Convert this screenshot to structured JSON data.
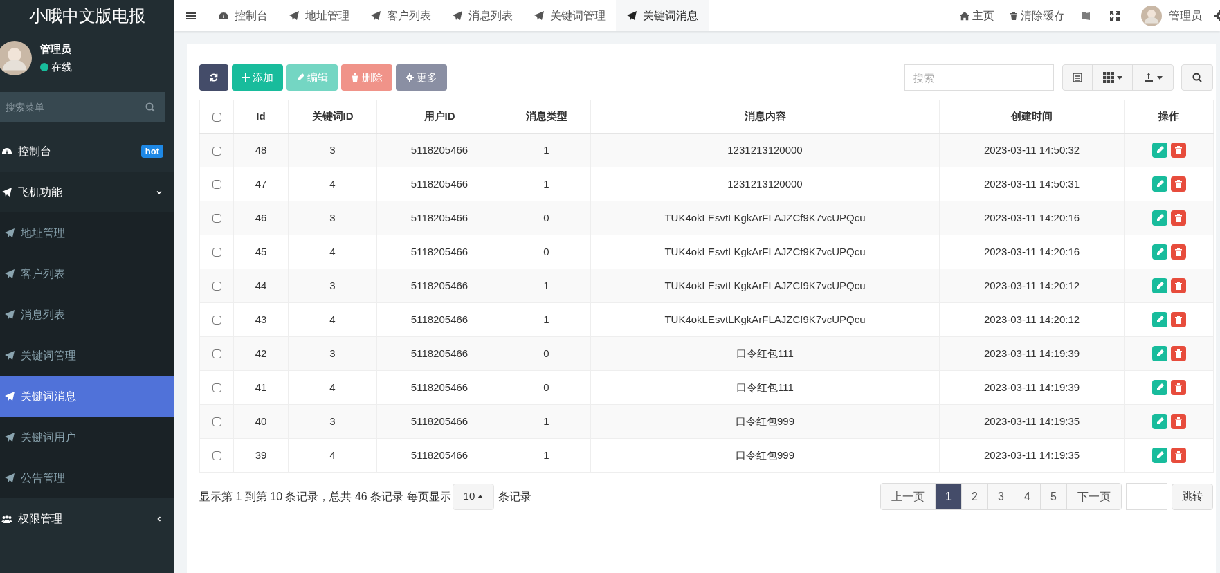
{
  "sidebar": {
    "title": "小哦中文版电报",
    "user": {
      "name": "管理员",
      "status": "在线"
    },
    "search": {
      "placeholder": "搜索菜单"
    },
    "items": [
      {
        "label": "控制台",
        "kind": "dashboard",
        "badge": "hot",
        "selected": false
      },
      {
        "label": "飞机功能",
        "kind": "plane",
        "expanded": true,
        "selected": false,
        "children": [
          {
            "label": "地址管理",
            "selected": false
          },
          {
            "label": "客户列表",
            "selected": false
          },
          {
            "label": "消息列表",
            "selected": false
          },
          {
            "label": "关键词管理",
            "selected": false
          },
          {
            "label": "关键词消息",
            "selected": true
          },
          {
            "label": "关键词用户",
            "selected": false
          },
          {
            "label": "公告管理",
            "selected": false
          }
        ]
      },
      {
        "label": "权限管理",
        "kind": "users",
        "expanded": false,
        "selected": false
      }
    ]
  },
  "tabs": [
    {
      "label": "控制台",
      "kind": "dashboard",
      "selected": false
    },
    {
      "label": "地址管理",
      "kind": "plane",
      "selected": false
    },
    {
      "label": "客户列表",
      "kind": "plane",
      "selected": false
    },
    {
      "label": "消息列表",
      "kind": "plane",
      "selected": false
    },
    {
      "label": "关键词管理",
      "kind": "plane",
      "selected": false
    },
    {
      "label": "关键词消息",
      "kind": "plane",
      "selected": true
    }
  ],
  "top_right": {
    "home": "主页",
    "clear_cache": "清除缓存",
    "user": "管理员"
  },
  "toolbar": {
    "buttons": [
      {
        "kind": "refresh",
        "disabled": false
      },
      {
        "kind": "add",
        "label": "添加",
        "disabled": false
      },
      {
        "kind": "edit",
        "label": "编辑",
        "disabled": true
      },
      {
        "kind": "delete",
        "label": "删除",
        "disabled": true
      },
      {
        "kind": "more",
        "label": "更多",
        "disabled": false
      }
    ],
    "search": {
      "placeholder": "搜索"
    }
  },
  "table": {
    "select_all_checked": false,
    "columns": [
      "Id",
      "关键词ID",
      "用户ID",
      "消息类型",
      "消息内容",
      "创建时间",
      "操作"
    ],
    "rows": [
      {
        "checked": false,
        "cells": [
          "48",
          "3",
          "5118205466",
          "1",
          "1231213120000",
          "2023-03-11 14:50:32"
        ]
      },
      {
        "checked": false,
        "cells": [
          "47",
          "4",
          "5118205466",
          "1",
          "1231213120000",
          "2023-03-11 14:50:31"
        ]
      },
      {
        "checked": false,
        "cells": [
          "46",
          "3",
          "5118205466",
          "0",
          "TUK4okLEsvtLKgkArFLAJZCf9K7vcUPQcu",
          "2023-03-11 14:20:16"
        ]
      },
      {
        "checked": false,
        "cells": [
          "45",
          "4",
          "5118205466",
          "0",
          "TUK4okLEsvtLKgkArFLAJZCf9K7vcUPQcu",
          "2023-03-11 14:20:16"
        ]
      },
      {
        "checked": false,
        "cells": [
          "44",
          "3",
          "5118205466",
          "1",
          "TUK4okLEsvtLKgkArFLAJZCf9K7vcUPQcu",
          "2023-03-11 14:20:12"
        ]
      },
      {
        "checked": false,
        "cells": [
          "43",
          "4",
          "5118205466",
          "1",
          "TUK4okLEsvtLKgkArFLAJZCf9K7vcUPQcu",
          "2023-03-11 14:20:12"
        ]
      },
      {
        "checked": false,
        "cells": [
          "42",
          "3",
          "5118205466",
          "0",
          "口令红包111",
          "2023-03-11 14:19:39"
        ]
      },
      {
        "checked": false,
        "cells": [
          "41",
          "4",
          "5118205466",
          "0",
          "口令红包111",
          "2023-03-11 14:19:39"
        ]
      },
      {
        "checked": false,
        "cells": [
          "40",
          "3",
          "5118205466",
          "1",
          "口令红包999",
          "2023-03-11 14:19:35"
        ]
      },
      {
        "checked": false,
        "cells": [
          "39",
          "4",
          "5118205466",
          "1",
          "口令红包999",
          "2023-03-11 14:19:35"
        ]
      }
    ]
  },
  "footer": {
    "summary": "显示第 1 到第 10 条记录，总共 46 条记录 每页显示",
    "page_size": "10",
    "suffix": "条记录",
    "pagination": {
      "prev": "上一页",
      "pages": [
        {
          "label": "1",
          "selected": true
        },
        {
          "label": "2",
          "selected": false
        },
        {
          "label": "3",
          "selected": false
        },
        {
          "label": "4",
          "selected": false
        },
        {
          "label": "5",
          "selected": false
        }
      ],
      "next": "下一页",
      "jump": "跳转"
    }
  }
}
